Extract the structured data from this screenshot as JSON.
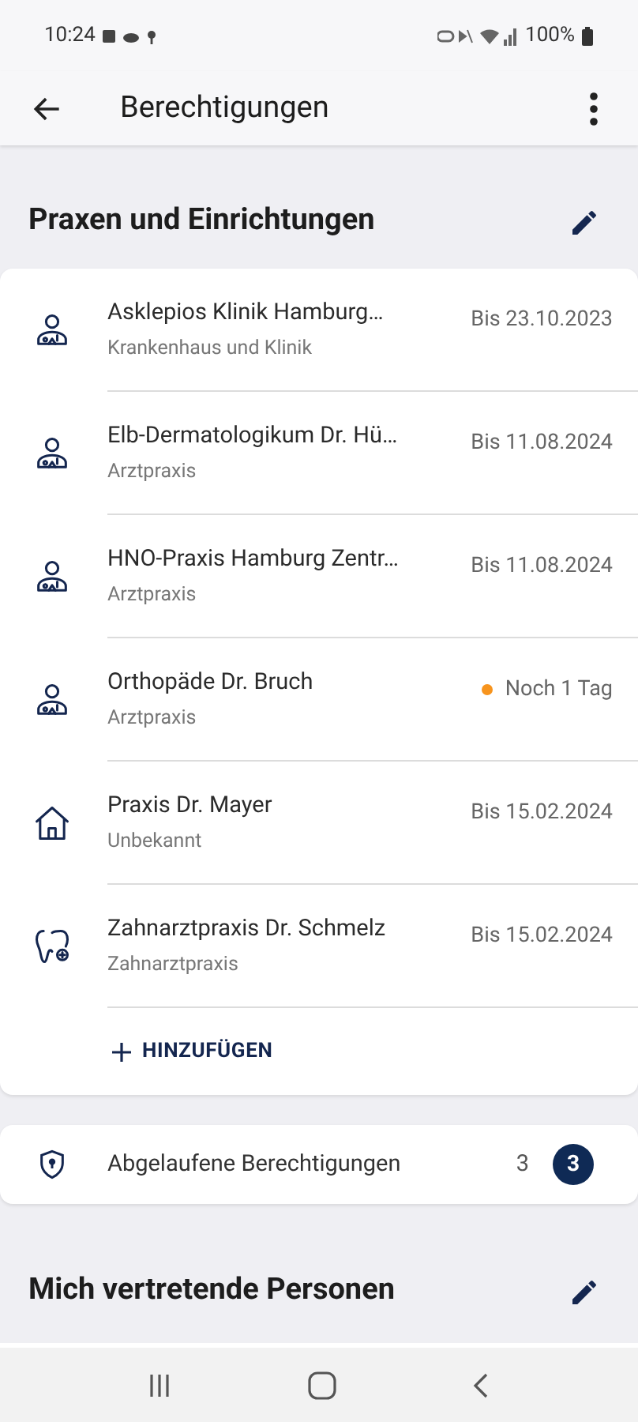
{
  "status_bar": {
    "time": "10:24",
    "battery": "100%"
  },
  "app_bar": {
    "title": "Berechtigungen"
  },
  "sections": [
    {
      "title": "Praxen und Einrichtungen"
    }
  ],
  "facilities": [
    {
      "kind": "doctor",
      "name": "Asklepios Klinik Hamburg…",
      "type": "Krankenhaus und Klinik",
      "validity": "Bis 23.10.2023",
      "warning": false
    },
    {
      "kind": "doctor",
      "name": "Elb-Dermatologikum Dr. Hü…",
      "type": "Arztpraxis",
      "validity": "Bis 11.08.2024",
      "warning": false
    },
    {
      "kind": "doctor",
      "name": "HNO-Praxis Hamburg Zentr…",
      "type": "Arztpraxis",
      "validity": "Bis 11.08.2024",
      "warning": false
    },
    {
      "kind": "doctor",
      "name": "Orthopäde Dr. Bruch",
      "type": "Arztpraxis",
      "validity": "Noch 1 Tag",
      "warning": true
    },
    {
      "kind": "house",
      "name": "Praxis Dr. Mayer",
      "type": "Unbekannt",
      "validity": "Bis 15.02.2024",
      "warning": false
    },
    {
      "kind": "tooth",
      "name": "Zahnarztpraxis Dr. Schmelz",
      "type": "Zahnarztpraxis",
      "validity": "Bis 15.02.2024",
      "warning": false
    }
  ],
  "add_button": {
    "label": "HINZUFÜGEN"
  },
  "expired": {
    "label": "Abgelaufene Berechtigungen",
    "count": "3",
    "badge": "3"
  },
  "sections_2": [
    {
      "title": "Mich vertretende Personen"
    }
  ]
}
